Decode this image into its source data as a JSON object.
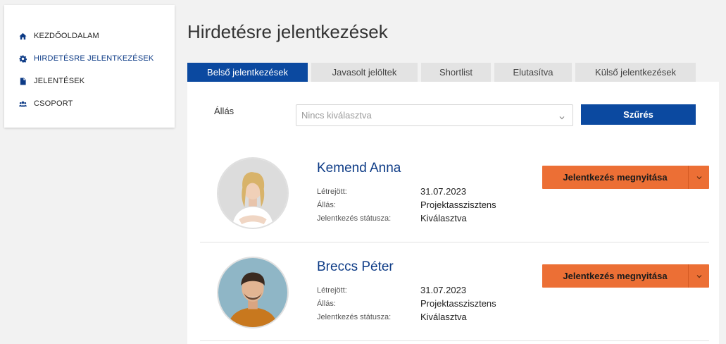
{
  "sidebar": {
    "items": [
      {
        "label": "KEZDŐOLDALAM",
        "icon": "home-icon"
      },
      {
        "label": "HIRDETÉSRE JELENTKEZÉSEK",
        "icon": "gear-icon",
        "active": true
      },
      {
        "label": "JELENTÉSEK",
        "icon": "document-icon"
      },
      {
        "label": "CSOPORT",
        "icon": "users-icon"
      }
    ]
  },
  "page": {
    "title": "Hirdetésre jelentkezések"
  },
  "tabs": [
    {
      "label": "Belső jelentkezések",
      "active": true
    },
    {
      "label": "Javasolt jelöltek"
    },
    {
      "label": "Shortlist"
    },
    {
      "label": "Elutasítva"
    },
    {
      "label": "Külső jelentkezések"
    }
  ],
  "filter": {
    "label": "Állás",
    "placeholder": "Nincs kiválasztva",
    "button": "Szűrés"
  },
  "candidates": [
    {
      "name": "Kemend Anna",
      "created_label": "Létrejött:",
      "created": "31.07.2023",
      "job_label": "Állás:",
      "job": "Projektasszisztens",
      "status_label": "Jelentkezés státusza:",
      "status": "Kiválasztva",
      "action": "Jelentkezés megnyitása"
    },
    {
      "name": "Breccs Péter",
      "created_label": "Létrejött:",
      "created": "31.07.2023",
      "job_label": "Állás:",
      "job": "Projektasszisztens",
      "status_label": "Jelentkezés státusza:",
      "status": "Kiválasztva",
      "action": "Jelentkezés megnyitása"
    }
  ],
  "colors": {
    "brand_blue": "#0b49a0",
    "accent_orange": "#ec6f35",
    "name_blue": "#0d3b86"
  }
}
